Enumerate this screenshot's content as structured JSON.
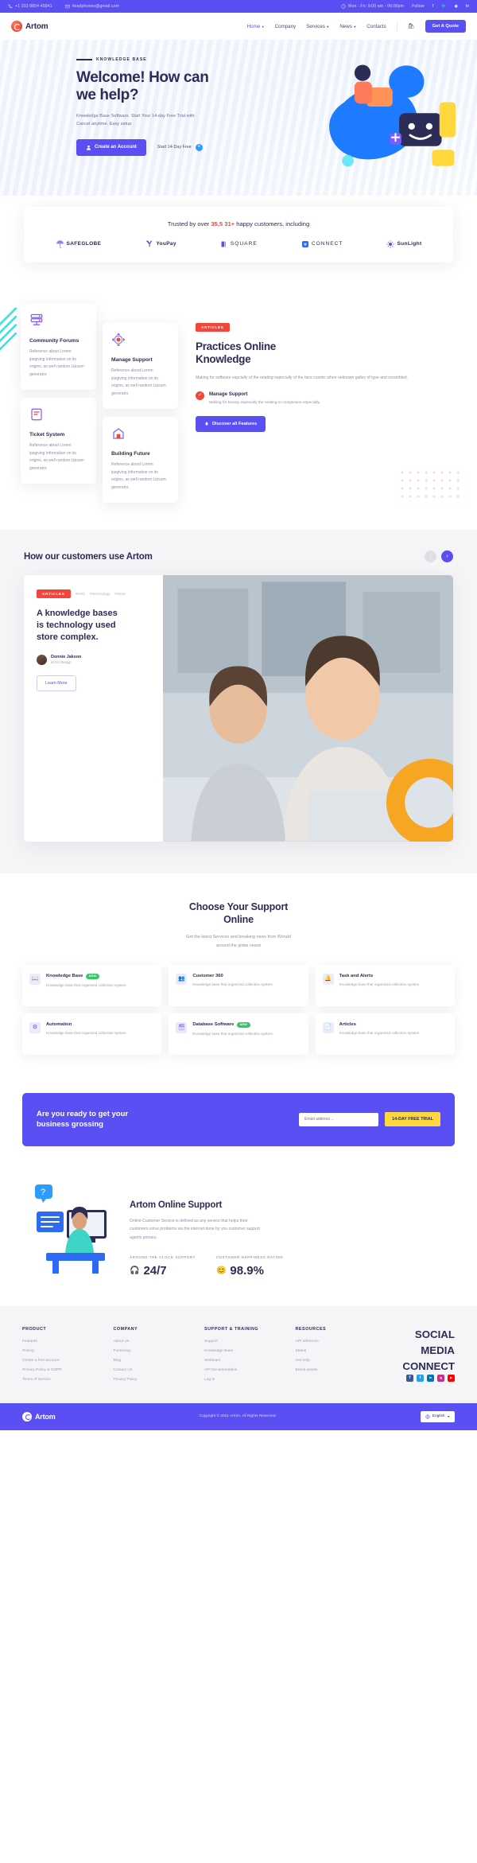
{
  "topbar": {
    "phone": "+1 333 8854 45841",
    "email": "headphones@gmail.com",
    "hours": "Mon - Fri: 9:00 am - 06:00pm",
    "follow_label": "Follow",
    "socials": [
      "facebook-icon",
      "twitter-icon",
      "dribbble-icon",
      "linkedin-icon"
    ]
  },
  "brand": {
    "name": "Artom"
  },
  "nav": {
    "items": [
      {
        "label": "Home",
        "caret": true,
        "active": true
      },
      {
        "label": "Company",
        "caret": false,
        "active": false
      },
      {
        "label": "Services",
        "caret": true,
        "active": false
      },
      {
        "label": "News",
        "caret": true,
        "active": false
      },
      {
        "label": "Contacts",
        "caret": false,
        "active": false
      }
    ],
    "cart_icon": "cart-icon",
    "quote_button": "Get A Quote"
  },
  "hero": {
    "kicker": "KNOWLEDGE BASE",
    "title_line1": "Welcome! How can",
    "title_line2": "we help?",
    "paragraph": "Knowledge Base Software. Start Your 14-day Free Trial with Cancel anytime. Easy setup",
    "primary_button": "Create an Account",
    "secondary_link": "Start 14-Day Free"
  },
  "trusted": {
    "prefix": "Trusted by over ",
    "highlight": "35,5 31+",
    "suffix": " happy customers, including",
    "logos": [
      {
        "name": "SAFEGLOBE",
        "icon": "umbrella-icon"
      },
      {
        "name": "YouPay",
        "icon": "y-icon"
      },
      {
        "name": "SQUARE",
        "icon": "square-icon"
      },
      {
        "name": "CONNECT",
        "icon": "connect-icon"
      },
      {
        "name": "SunLight",
        "icon": "sun-icon"
      }
    ]
  },
  "features": {
    "cards": [
      {
        "title": "Community Forums",
        "text": "Reference about Lorem ipsgiving information on its origins, as well random Lipsum generator.",
        "icon": "server-stack-icon"
      },
      {
        "title": "Manage Support",
        "text": "Reference about Lorem ipsgiving information on its origins, as well random Lipsum generator.",
        "icon": "arrows-target-icon"
      },
      {
        "title": "Ticket System",
        "text": "Reference about Lorem ipsgiving information on its origins, as well random Lipsum generator.",
        "icon": "ticket-icon"
      },
      {
        "title": "Building Future",
        "text": "Reference about Lorem ipsgiving information on its origins, as well random Lipsum generator.",
        "icon": "building-icon"
      }
    ],
    "badge": "ARTICLES",
    "heading_line1": "Practices Online",
    "heading_line2": "Knowledge",
    "lead": "Making for software espcially of the relating especially of the face cosmic when unknown galley of type and scrambled.",
    "check_title": "Manage Support",
    "check_text": "Making for beauty especially the relating to complesion especially.",
    "button": "Discover all Features"
  },
  "customers": {
    "heading": "How our customers use Artom",
    "prev_arrow": "chevron-left-icon",
    "next_arrow": "chevron-right-icon",
    "badge": "ARTICLES",
    "tags": [
      "#Html",
      "#Technology",
      "#Store"
    ],
    "quote_line1": "A knowledge bases",
    "quote_line2": "is technology used",
    "quote_line3": "store complex.",
    "author_name": "Donnie Jakson",
    "author_role": "at UX Design",
    "button": "Learn More"
  },
  "choose": {
    "heading_line1": "Choose Your Support",
    "heading_line2": "Online",
    "sub_line1": "Get the latest Services and breaking news from Worald",
    "sub_line2": "around the globe newst",
    "cards": [
      {
        "title": "Knowledge Base",
        "badge": "NEW",
        "text": "Knowledge base that organized collection system",
        "icon": "book-icon"
      },
      {
        "title": "Customer 360",
        "badge": "",
        "text": "Knowledge base that organized collection system",
        "icon": "users-icon"
      },
      {
        "title": "Task and Alerts",
        "badge": "",
        "text": "Knowledge base that organized collection system",
        "icon": "bell-icon"
      },
      {
        "title": "Automation",
        "badge": "",
        "text": "Knowledge base that organized collection system",
        "icon": "gear-icon"
      },
      {
        "title": "Database Software",
        "badge": "NEW",
        "text": "Knowledge base that organized collection system",
        "icon": "database-icon"
      },
      {
        "title": "Articles",
        "badge": "",
        "text": "Knowledge base that organized collection system",
        "icon": "file-icon"
      }
    ]
  },
  "cta": {
    "heading_line1": "Are you ready to get your",
    "heading_line2": "business grossing",
    "input_placeholder": "Email address ...",
    "button": "14-DAY FREE TRIAL"
  },
  "online": {
    "heading": "Artom Online Support",
    "paragraph": "Online Customer Service is defined as any service that helps their customers solve problems via the internet done by you customer support agents primary.",
    "stats": [
      {
        "label": "AROUND THE CLOCK SUPPORT",
        "value": "24/7",
        "icon": "headset-icon"
      },
      {
        "label": "CUSTOMER HAPPINESS RATING",
        "value": "98.9%",
        "icon": "smile-icon"
      }
    ]
  },
  "footer": {
    "columns": [
      {
        "title": "PRODUCT",
        "links": [
          "Features",
          "Pricing",
          "Create a free account",
          "Privacy Policy & GDPR",
          "Terms of Service"
        ]
      },
      {
        "title": "COMPANY",
        "links": [
          "About Us",
          "FunnelJoy",
          "Blog",
          "Contact Us",
          "Privacy Policy"
        ]
      },
      {
        "title": "SUPPORT & TRAINING",
        "links": [
          "Support",
          "Knowledge Base",
          "Webinars",
          "API Documentation",
          "Log In"
        ]
      },
      {
        "title": "RESOURCES",
        "links": [
          "API reference",
          "Status",
          "Get help",
          "Brand assets"
        ]
      }
    ],
    "social_title_line1": "SOCIAL MEDIA",
    "social_title_line2": "CONNECT",
    "socials": [
      {
        "icon": "facebook-icon",
        "color": "#3b5998",
        "glyph": "f"
      },
      {
        "icon": "twitter-icon",
        "color": "#1da1f2",
        "glyph": "t"
      },
      {
        "icon": "linkedin-icon",
        "color": "#0077b5",
        "glyph": "in"
      },
      {
        "icon": "instagram-icon",
        "color": "#c13584",
        "glyph": "ig"
      },
      {
        "icon": "youtube-icon",
        "color": "#ff0000",
        "glyph": "yt"
      }
    ]
  },
  "bottombar": {
    "brand": "Artom",
    "copyright": "Copyright © 2021 Artom. All Rights Reserved.",
    "language": "English",
    "globe_icon": "globe-icon"
  },
  "colors": {
    "primary": "#5a4ff3",
    "accent_red": "#f4453a",
    "accent_yellow": "#ffd83d",
    "text_dark": "#2b2d56",
    "text_muted": "#8d90ad"
  }
}
